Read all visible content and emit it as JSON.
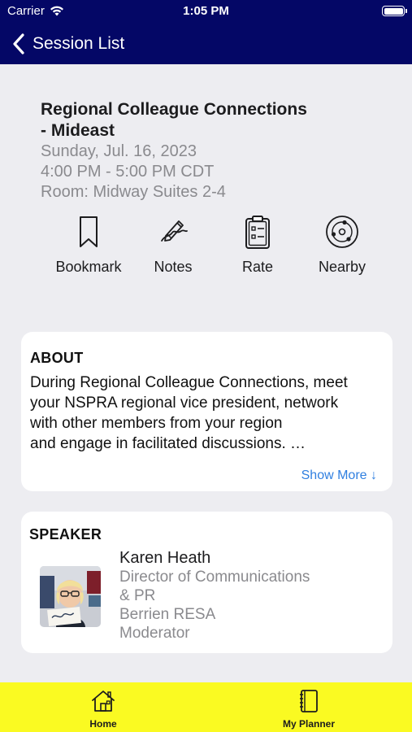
{
  "status_bar": {
    "carrier": "Carrier",
    "time": "1:05 PM"
  },
  "nav": {
    "back_label": "Session List"
  },
  "session": {
    "title_line1": "Regional Colleague Connections",
    "title_line2": "- Mideast",
    "date": "Sunday, Jul. 16, 2023",
    "time": "4:00 PM - 5:00 PM CDT",
    "room": "Room: Midway Suites 2-4"
  },
  "actions": [
    {
      "label": "Bookmark",
      "icon": "bookmark-icon"
    },
    {
      "label": "Notes",
      "icon": "notes-icon"
    },
    {
      "label": "Rate",
      "icon": "clipboard-icon"
    },
    {
      "label": "Nearby",
      "icon": "nearby-icon"
    }
  ],
  "about": {
    "heading": "ABOUT",
    "lines": [
      "During Regional Colleague Connections, meet",
      "your NSPRA regional vice president, network",
      "with other members from your region",
      "and engage in facilitated discussions. …"
    ],
    "show_more": "Show More ↓"
  },
  "speaker": {
    "heading": "SPEAKER",
    "name": "Karen Heath",
    "title_line1": "Director of Communications",
    "title_line2": "& PR",
    "organization": "Berrien RESA",
    "role": "Moderator"
  },
  "tabs": [
    {
      "label": "Home",
      "icon": "home-icon"
    },
    {
      "label": "My Planner",
      "icon": "planner-icon"
    }
  ],
  "colors": {
    "nav_background": "#040766",
    "tab_background": "#fafa22",
    "link": "#2f7fe0",
    "page_background": "#ededf1"
  }
}
